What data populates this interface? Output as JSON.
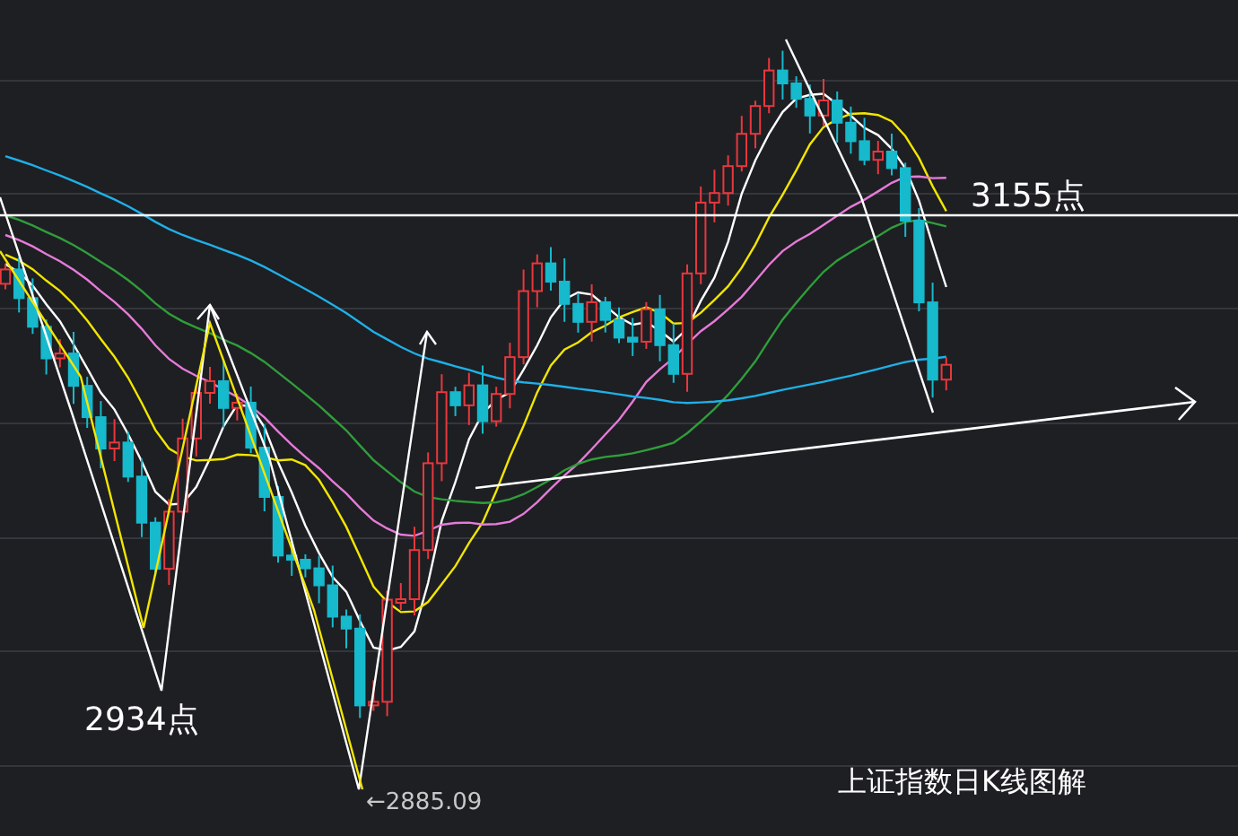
{
  "annotations": [
    {
      "kind": "resistance",
      "text": "3155点"
    },
    {
      "kind": "low",
      "text": "2934点"
    },
    {
      "kind": "low_arrow",
      "text": "←2885.09"
    }
  ],
  "caption": "上证指数日K线图解"
}
